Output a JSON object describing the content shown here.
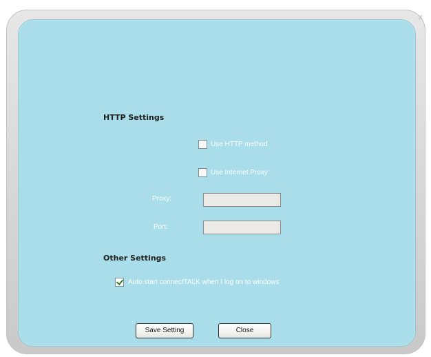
{
  "window": {
    "close_glyph": "x"
  },
  "http_settings": {
    "title": "HTTP Settings",
    "use_http_method": {
      "label": "Use HTTP method",
      "checked": false
    },
    "use_internet_proxy": {
      "label": "Use Internet Proxy",
      "checked": false
    },
    "proxy": {
      "label": "Proxy:",
      "value": "",
      "placeholder": ""
    },
    "port": {
      "label": "Port:",
      "value": "",
      "placeholder": ""
    }
  },
  "other_settings": {
    "title": "Other Settings",
    "auto_start": {
      "label": "Auto start connectTALK when I log on to windows",
      "checked": true
    }
  },
  "buttons": {
    "save": "Save Setting",
    "close": "Close"
  },
  "colors": {
    "panel_background": "#a8dde9",
    "frame_background": "#dcdcdc",
    "label_text": "#ffffff",
    "title_text": "#202020"
  }
}
